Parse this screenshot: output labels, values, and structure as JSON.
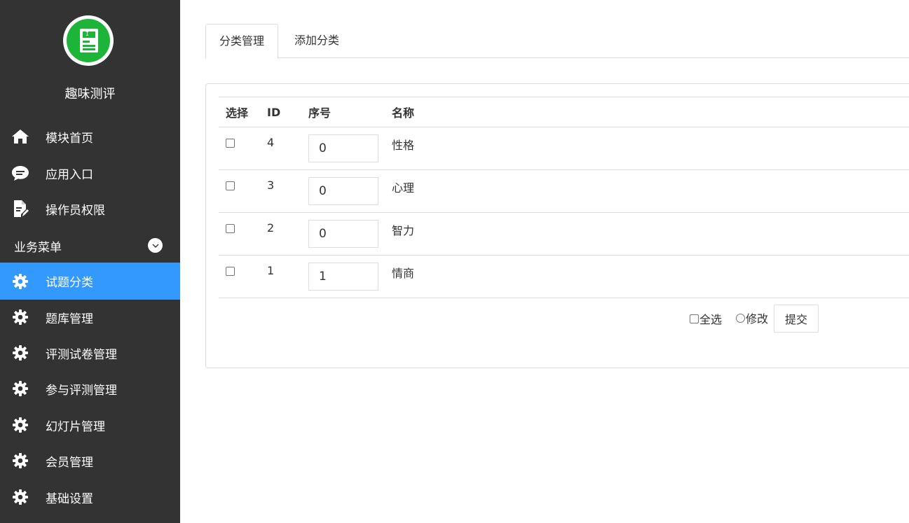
{
  "sidebar": {
    "site_name": "趣味测评",
    "top_items": [
      {
        "label": "模块首页",
        "icon": "home-icon"
      },
      {
        "label": "应用入口",
        "icon": "chat-bubble-icon"
      },
      {
        "label": "操作员权限",
        "icon": "document-edit-icon"
      }
    ],
    "section_label": "业务菜单",
    "section_items": [
      {
        "label": "试题分类",
        "icon": "gear-icon",
        "active": true
      },
      {
        "label": "题库管理",
        "icon": "gear-icon"
      },
      {
        "label": "评测试卷管理",
        "icon": "gear-icon"
      },
      {
        "label": "参与评测管理",
        "icon": "gear-icon"
      },
      {
        "label": "幻灯片管理",
        "icon": "gear-icon"
      },
      {
        "label": "会员管理",
        "icon": "gear-icon"
      },
      {
        "label": "基础设置",
        "icon": "gear-icon"
      }
    ],
    "active_color": "#3399ff",
    "background_color": "#333333"
  },
  "tabs": [
    {
      "label": "分类管理",
      "active": true
    },
    {
      "label": "添加分类",
      "active": false
    }
  ],
  "table": {
    "headers": [
      "选择",
      "ID",
      "序号",
      "名称"
    ],
    "rows": [
      {
        "id": "4",
        "seq": "0",
        "name": "性格"
      },
      {
        "id": "3",
        "seq": "0",
        "name": "心理"
      },
      {
        "id": "2",
        "seq": "0",
        "name": "智力"
      },
      {
        "id": "1",
        "seq": "1",
        "name": "情商"
      }
    ]
  },
  "footer": {
    "select_all_label": "全选",
    "modify_label": "修改",
    "submit_label": "提交"
  }
}
